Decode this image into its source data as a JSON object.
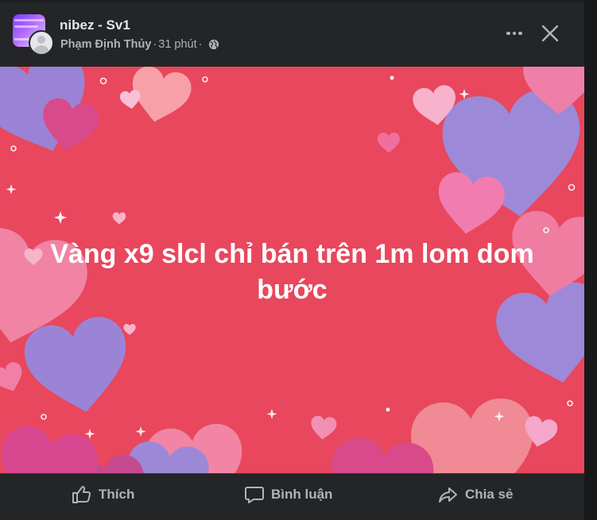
{
  "post": {
    "group_name": "nibez - Sv1",
    "author": "Phạm Định Thủy",
    "separator": "·",
    "time": "31 phút",
    "privacy_icon": "globe-icon",
    "background_text": "Vàng x9 slcl chỉ bán trên 1m lom dom bước",
    "background_color": "#e8475d"
  },
  "header_actions": {
    "more_icon": "more-horizontal-icon",
    "close_icon": "close-icon"
  },
  "actions": {
    "like_label": "Thích",
    "comment_label": "Bình luận",
    "share_label": "Chia sẻ"
  },
  "colors": {
    "surface": "#242526",
    "text_primary": "#e4e6eb",
    "text_secondary": "#b0b3b8"
  }
}
